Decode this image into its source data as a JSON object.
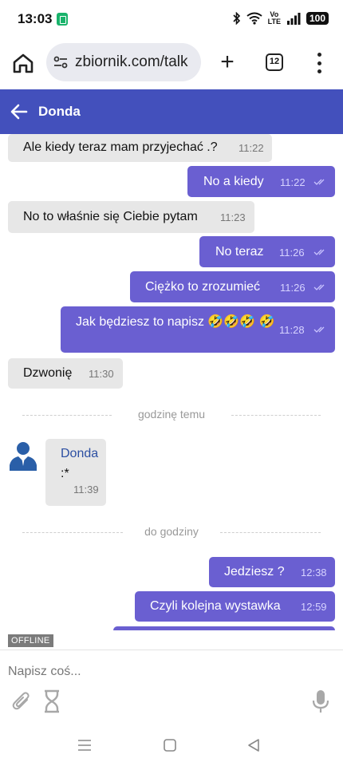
{
  "status_bar": {
    "time": "13:03",
    "volte_top": "Vo",
    "volte_bottom": "LTE",
    "battery": "100"
  },
  "browser": {
    "url": "zbiornik.com/talk",
    "tab_count": "12"
  },
  "chat": {
    "title": "Donda",
    "messages": [
      {
        "dir": "in",
        "text": "Ale kiedy teraz mam przyjechać .?",
        "time": "11:22"
      },
      {
        "dir": "out",
        "text": "No a kiedy",
        "time": "11:22"
      },
      {
        "dir": "in",
        "text": "No to właśnie się Ciebie pytam",
        "time": "11:23"
      },
      {
        "dir": "out",
        "text": "No teraz",
        "time": "11:26"
      },
      {
        "dir": "out",
        "text": "Ciężko to zrozumieć",
        "time": "11:26"
      },
      {
        "dir": "out",
        "text": "Jak będziesz to napisz 🤣🤣🤣 🤣",
        "time": "11:28"
      },
      {
        "dir": "in",
        "text": "Dzwonię",
        "time": "11:30"
      }
    ],
    "separator_1": "godzinę temu",
    "group_message": {
      "sender": "Donda",
      "text": ":*",
      "time": "11:39"
    },
    "separator_2": "do godziny",
    "messages_2": [
      {
        "dir": "out",
        "text": "Jedziesz ?",
        "time": "12:38"
      },
      {
        "dir": "out",
        "text": "Czyli kolejna wystawka",
        "time": "12:59"
      }
    ]
  },
  "composer": {
    "status_badge": "OFFLINE",
    "placeholder": "Napisz coś..."
  },
  "colors": {
    "header": "#4350bc",
    "outgoing_bubble": "#6a5fd1",
    "incoming_bubble": "#e7e7e7",
    "sender_name": "#2c4fa2"
  },
  "icons": [
    "home-icon",
    "site-settings-icon",
    "plus-icon",
    "tabs-icon",
    "more-vert-icon",
    "back-arrow-icon",
    "read-ticks-icon",
    "avatar-icon",
    "paperclip-icon",
    "hourglass-icon",
    "microphone-icon",
    "recents-icon",
    "home-nav-icon",
    "back-nav-icon"
  ]
}
